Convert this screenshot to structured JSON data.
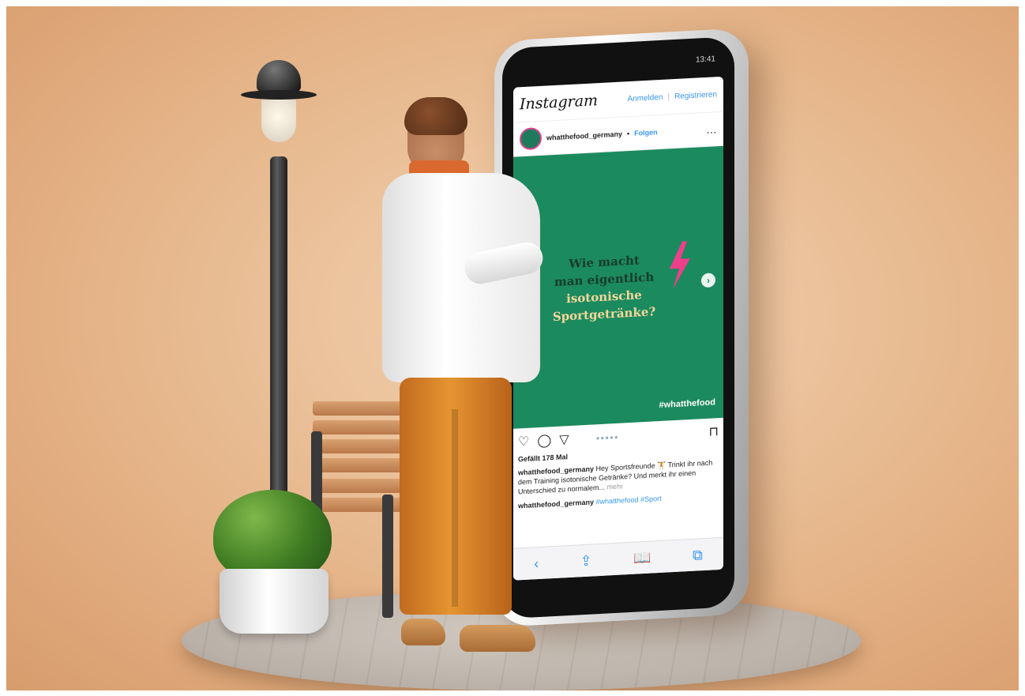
{
  "phone": {
    "status_time": "13:41",
    "instagram": {
      "logo": "Instagram",
      "login_label": "Anmelden",
      "register_label": "Registrieren",
      "username": "whatthefood_germany",
      "separator": "•",
      "follow_label": "Folgen",
      "more_icon": "…"
    },
    "post": {
      "line1": "Wie macht",
      "line2": "man eigentlich",
      "line3": "isotonische",
      "line4": "Sportgetränke?",
      "hashtag": "#whatthefood",
      "next_icon": "›",
      "accent_color": "#1c8a5f",
      "bolt_color": "#ee3f8a"
    },
    "actions": {
      "like_icon": "♡",
      "comment_icon": "◯",
      "share_icon": "▽",
      "dots": "●●●●●",
      "bookmark_icon": "⊓"
    },
    "likes": "Gefällt 178 Mal",
    "caption": {
      "user": "whatthefood_germany",
      "text": "Hey Sportsfreunde 🏋 Trinkt ihr nach dem Training isotonische Getränke? Und merkt ihr einen Unterschied zu normalem...",
      "more": "mehr"
    },
    "comment": {
      "user": "whatthefood_germany",
      "tags": "#whatthefood #Sport"
    },
    "safari_bar": {
      "back_icon": "‹",
      "share_icon": "⇪",
      "bookmarks_icon": "📖",
      "tabs_icon": "⧉"
    }
  }
}
